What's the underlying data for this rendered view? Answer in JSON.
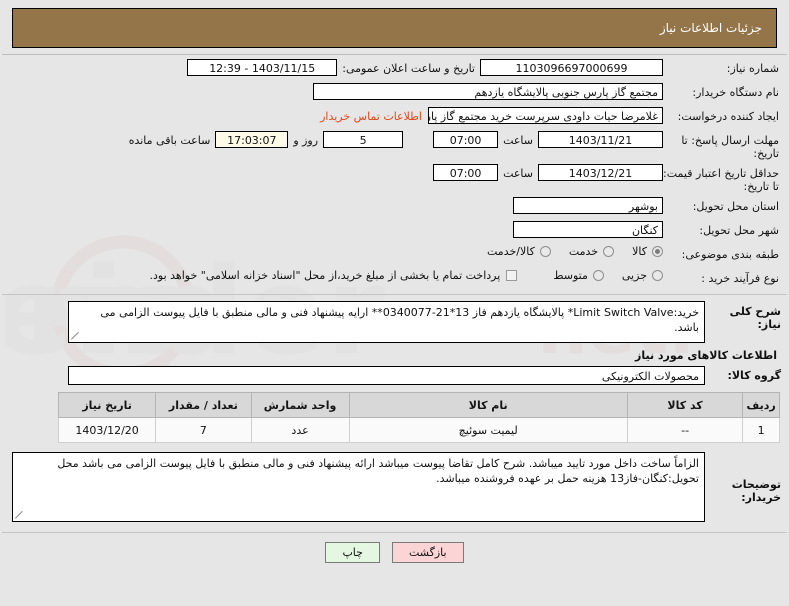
{
  "header": {
    "title": "جزئیات اطلاعات نیاز"
  },
  "form": {
    "need_number_label": "شماره نیاز:",
    "need_number_value": "1103096697000699",
    "announce_datetime_label": "تاریخ و ساعت اعلان عمومی:",
    "announce_datetime_value": "1403/11/15 - 12:39",
    "buyer_org_label": "نام دستگاه خریدار:",
    "buyer_org_value": "مجتمع گاز پارس جنوبی  پالایشگاه یازدهم",
    "creator_label": "ایجاد کننده درخواست:",
    "creator_value": "غلامرضا حیات داودی سرپرست خرید مجتمع گاز پارس جنوبی  پالایشگاه یازدهم",
    "contact_link": "اطلاعات تماس خریدار",
    "deadline_label": "مهلت ارسال پاسخ: تا تاریخ:",
    "deadline_date": "1403/11/21",
    "deadline_hour_label": "ساعت",
    "deadline_time": "07:00",
    "remaining_days": "5",
    "remaining_days_label": "روز و",
    "remaining_time": "17:03:07",
    "remaining_time_label": "ساعت باقی مانده",
    "price_validity_label": "حداقل تاریخ اعتبار قیمت: تا تاریخ:",
    "price_validity_date": "1403/12/21",
    "price_validity_hour_label": "ساعت",
    "price_validity_time": "07:00",
    "province_label": "استان محل تحویل:",
    "province_value": "بوشهر",
    "city_label": "شهر محل تحویل:",
    "city_value": "کنگان",
    "category_label": "طبقه بندی موضوعی:",
    "category_options": [
      {
        "label": "کالا",
        "selected": true
      },
      {
        "label": "خدمت",
        "selected": false
      },
      {
        "label": "کالا/خدمت",
        "selected": false
      }
    ],
    "process_label": "نوع فرآیند خرید :",
    "process_options": [
      {
        "label": "جزیی",
        "selected": false
      },
      {
        "label": "متوسط",
        "selected": false
      }
    ],
    "treasury_checkbox_checked": false,
    "treasury_note": "پرداخت تمام یا بخشی از مبلغ خرید،از محل \"اسناد خزانه اسلامی\" خواهد بود."
  },
  "description": {
    "label": "شرح کلی نیاز:",
    "text": "خرید:Limit Switch Valve* پالایشگاه یازدهم فاز 13*21-0340077** ارایه پیشنهاد فنی و مالی منطبق با فایل پیوست الزامی می باشد."
  },
  "goods_section": {
    "title": "اطلاعات کالاهای مورد نیاز",
    "group_label": "گروه کالا:",
    "group_value": "محصولات الکترونیکی",
    "columns": [
      "ردیف",
      "کد کالا",
      "نام کالا",
      "واحد شمارش",
      "تعداد / مقدار",
      "تاریخ نیاز"
    ],
    "rows": [
      {
        "index": "1",
        "code": "--",
        "name": "لیمیت سوئیچ",
        "unit": "عدد",
        "quantity": "7",
        "need_date": "1403/12/20"
      }
    ]
  },
  "notes": {
    "label": "توضیحات خریدار:",
    "text": "الزاماً ساخت داخل مورد تایید میباشد. شرح کامل تقاضا پیوست میباشد ارائه پیشنهاد فنی و مالی منطبق با فایل پیوست الزامی می باشد محل تحویل:کنگان-فاز13 هزینه حمل بر عهده فروشنده میباشد."
  },
  "footer": {
    "back_label": "بازگشت",
    "print_label": "چاپ"
  },
  "colors": {
    "header_bg": "#94754a",
    "link": "#e2481a",
    "back_btn": "#fbd5d5",
    "print_btn": "#e4f7e0"
  }
}
